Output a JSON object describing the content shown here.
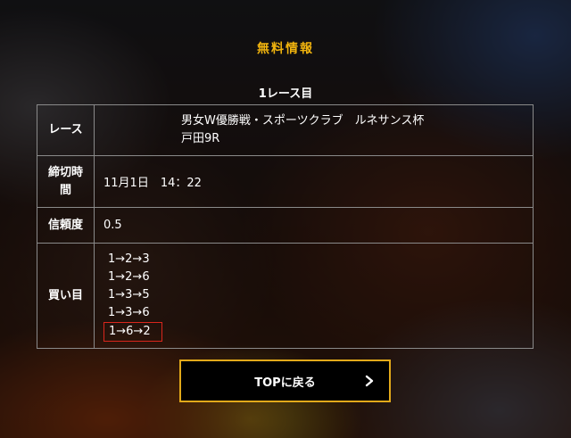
{
  "section": {
    "title": "無料情報"
  },
  "race": {
    "heading": "1レース目"
  },
  "table": {
    "race_label": "レース",
    "race_value_line1": "男女W優勝戦・スポーツクラブ　ルネサンス杯",
    "race_value_line2": "戸田9R",
    "deadline_label_line1": "締切時",
    "deadline_label_line2": "間",
    "deadline_value": "11月1日　14：22",
    "trust_label": "信頼度",
    "trust_value": "0.5",
    "buy_label": "買い目",
    "buy_items": [
      "1→2→3",
      "1→2→6",
      "1→3→5",
      "1→3→6",
      "1→6→2"
    ]
  },
  "button": {
    "label": "TOPに戻る",
    "icon": "chevron-right-icon"
  },
  "colors": {
    "heading": "#f0b30e",
    "button_border": "#e2a91a",
    "highlight_border": "#d9261c"
  }
}
